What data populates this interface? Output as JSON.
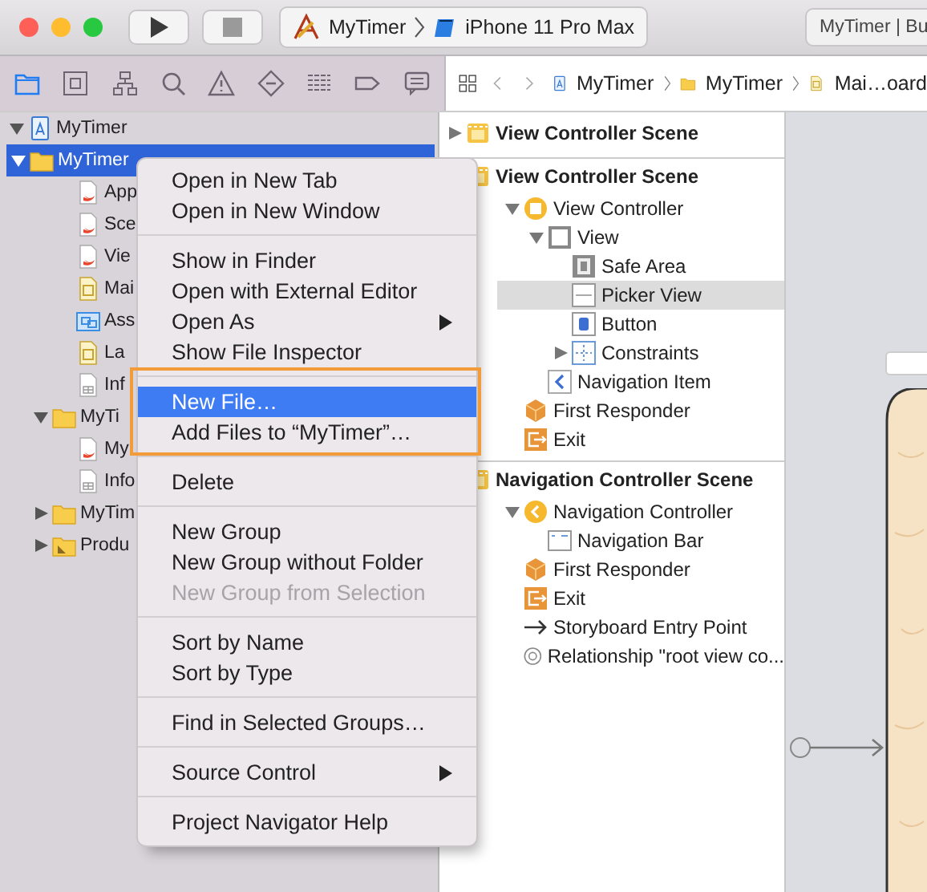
{
  "toolbar": {
    "scheme": {
      "target": "MyTimer",
      "device": "iPhone 11 Pro Max"
    },
    "activity": "MyTimer | Bu"
  },
  "navigator": {
    "tabs": [
      {
        "kind": "files",
        "selected": true
      },
      {
        "kind": "source",
        "selected": false
      },
      {
        "kind": "symbols",
        "selected": false
      },
      {
        "kind": "find",
        "selected": false
      },
      {
        "kind": "issues",
        "selected": false
      },
      {
        "kind": "tests",
        "selected": false
      },
      {
        "kind": "debug",
        "selected": false
      },
      {
        "kind": "breakpoints",
        "selected": false
      },
      {
        "kind": "reports",
        "selected": false
      }
    ],
    "tree": [
      {
        "label": "MyTimer",
        "kind": "project",
        "expanded": true,
        "selected": false,
        "children": [
          {
            "label": "MyTimer",
            "kind": "folder",
            "expanded": true,
            "selected": true,
            "children": [
              {
                "label": "App",
                "kind": "swift",
                "selected": false
              },
              {
                "label": "Sce",
                "kind": "swift",
                "selected": false
              },
              {
                "label": "Vie",
                "kind": "swift",
                "selected": false
              },
              {
                "label": "Mai",
                "kind": "storyboard",
                "selected": false
              },
              {
                "label": "Ass",
                "kind": "assets",
                "selected": false
              },
              {
                "label": "La",
                "kind": "storyboard",
                "selected": false
              },
              {
                "label": "Inf",
                "kind": "plist",
                "selected": false
              }
            ]
          },
          {
            "label": "MyTi",
            "kind": "folder",
            "expanded": true,
            "selected": false,
            "children": [
              {
                "label": "My",
                "kind": "swift",
                "selected": false
              },
              {
                "label": "Info",
                "kind": "plist",
                "selected": false
              }
            ]
          },
          {
            "label": "MyTim",
            "kind": "folder",
            "expanded": false,
            "selected": false
          },
          {
            "label": "Produ",
            "kind": "products",
            "expanded": false,
            "selected": false
          }
        ]
      }
    ]
  },
  "jump_bar": [
    {
      "label": "MyTimer",
      "kind": "project"
    },
    {
      "label": "MyTimer",
      "kind": "folder"
    },
    {
      "label": "Mai…oard",
      "kind": "storyboard"
    }
  ],
  "context_menu": [
    {
      "kind": "item",
      "label": "Open in New Tab",
      "selected": false,
      "disabled": false,
      "submenu": false
    },
    {
      "kind": "item",
      "label": "Open in New Window",
      "selected": false,
      "disabled": false,
      "submenu": false
    },
    {
      "kind": "separator"
    },
    {
      "kind": "item",
      "label": "Show in Finder",
      "selected": false,
      "disabled": false,
      "submenu": false
    },
    {
      "kind": "item",
      "label": "Open with External Editor",
      "selected": false,
      "disabled": false,
      "submenu": false
    },
    {
      "kind": "item",
      "label": "Open As",
      "selected": false,
      "disabled": false,
      "submenu": true
    },
    {
      "kind": "item",
      "label": "Show File Inspector",
      "selected": false,
      "disabled": false,
      "submenu": false
    },
    {
      "kind": "separator"
    },
    {
      "kind": "item",
      "label": "New File…",
      "selected": true,
      "disabled": false,
      "submenu": false
    },
    {
      "kind": "item",
      "label": "Add Files to “MyTimer”…",
      "selected": false,
      "disabled": false,
      "submenu": false
    },
    {
      "kind": "separator"
    },
    {
      "kind": "item",
      "label": "Delete",
      "selected": false,
      "disabled": false,
      "submenu": false
    },
    {
      "kind": "separator"
    },
    {
      "kind": "item",
      "label": "New Group",
      "selected": false,
      "disabled": false,
      "submenu": false
    },
    {
      "kind": "item",
      "label": "New Group without Folder",
      "selected": false,
      "disabled": false,
      "submenu": false
    },
    {
      "kind": "item",
      "label": "New Group from Selection",
      "selected": false,
      "disabled": true,
      "submenu": false
    },
    {
      "kind": "separator"
    },
    {
      "kind": "item",
      "label": "Sort by Name",
      "selected": false,
      "disabled": false,
      "submenu": false
    },
    {
      "kind": "item",
      "label": "Sort by Type",
      "selected": false,
      "disabled": false,
      "submenu": false
    },
    {
      "kind": "separator"
    },
    {
      "kind": "item",
      "label": "Find in Selected Groups…",
      "selected": false,
      "disabled": false,
      "submenu": false
    },
    {
      "kind": "separator"
    },
    {
      "kind": "item",
      "label": "Source Control",
      "selected": false,
      "disabled": false,
      "submenu": true
    },
    {
      "kind": "separator"
    },
    {
      "kind": "item",
      "label": "Project Navigator Help",
      "selected": false,
      "disabled": false,
      "submenu": false
    }
  ],
  "outline": [
    {
      "title": "View Controller Scene",
      "expanded": false
    },
    {
      "title": "View Controller Scene",
      "expanded": true,
      "items": [
        {
          "label": "View Controller",
          "kind": "controller",
          "expanded": true,
          "selected": false,
          "children": [
            {
              "label": "View",
              "kind": "view",
              "expanded": true,
              "selected": false,
              "children": [
                {
                  "label": "Safe Area",
                  "kind": "safearea",
                  "selected": false
                },
                {
                  "label": "Picker View",
                  "kind": "picker",
                  "selected": true
                },
                {
                  "label": "Button",
                  "kind": "button",
                  "selected": false
                },
                {
                  "label": "Constraints",
                  "kind": "constraints",
                  "expanded": false,
                  "selected": false
                }
              ]
            },
            {
              "label": "Navigation Item",
              "kind": "navitem",
              "selected": false
            }
          ]
        },
        {
          "label": "First Responder",
          "kind": "responder",
          "selected": false
        },
        {
          "label": "Exit",
          "kind": "exit",
          "selected": false
        }
      ]
    },
    {
      "title": "Navigation Controller Scene",
      "expanded": true,
      "items": [
        {
          "label": "Navigation Controller",
          "kind": "navcontroller",
          "expanded": true,
          "selected": false,
          "children": [
            {
              "label": "Navigation Bar",
              "kind": "navbar",
              "selected": false
            }
          ]
        },
        {
          "label": "First Responder",
          "kind": "responder",
          "selected": false
        },
        {
          "label": "Exit",
          "kind": "exit",
          "selected": false
        },
        {
          "label": "Storyboard Entry Point",
          "kind": "entry",
          "selected": false
        },
        {
          "label": "Relationship \"root view co...",
          "kind": "relationship",
          "selected": false
        }
      ]
    }
  ]
}
